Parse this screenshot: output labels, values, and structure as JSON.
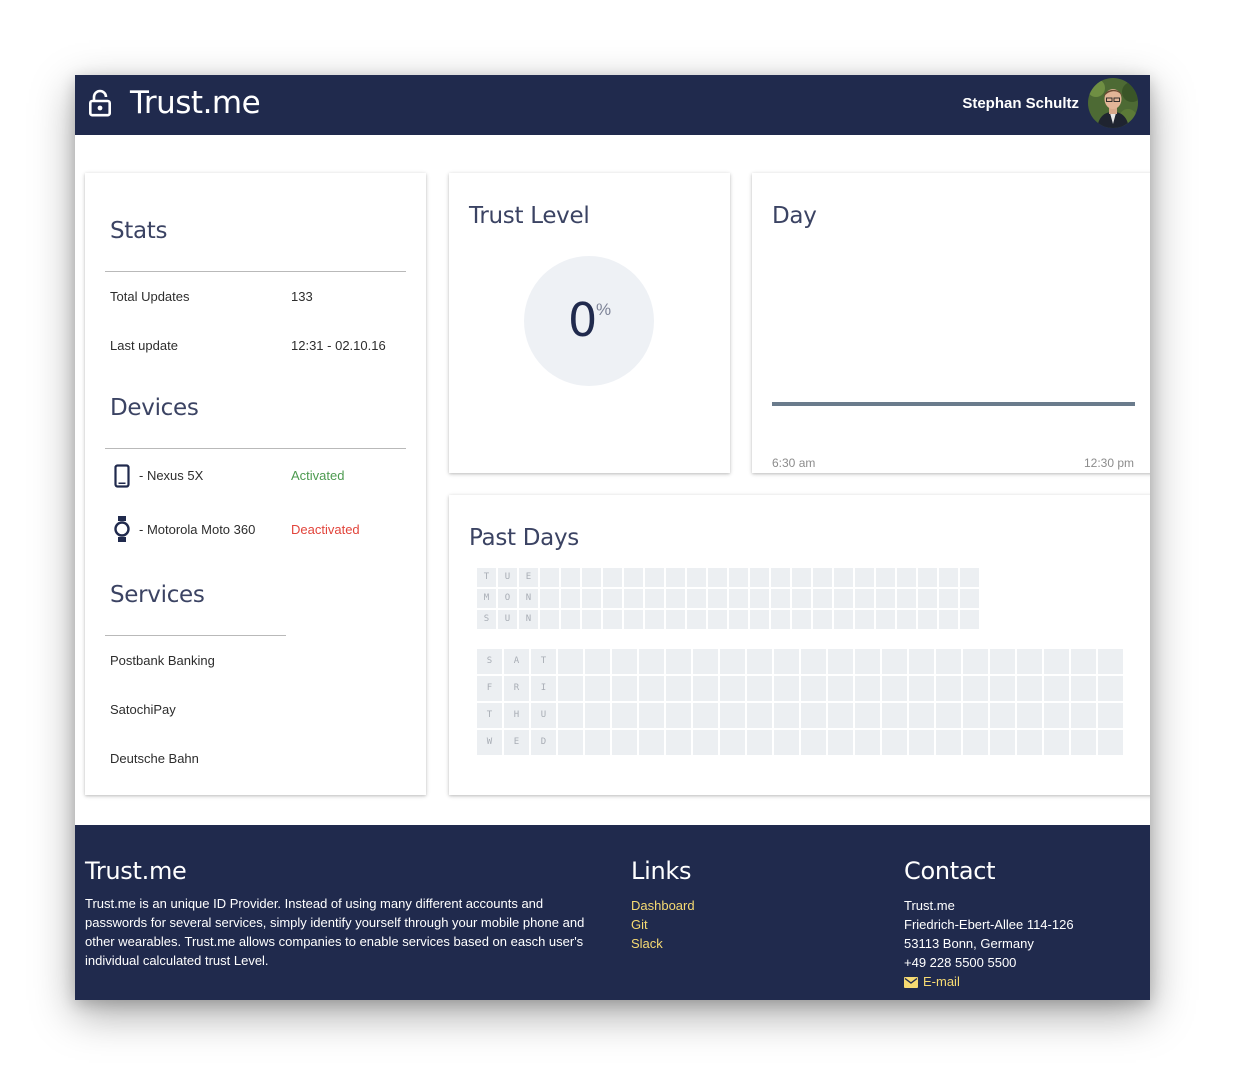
{
  "header": {
    "title": "Trust.me",
    "user_name": "Stephan Schultz"
  },
  "stats": {
    "title": "Stats",
    "rows": [
      {
        "label": "Total Updates",
        "value": "133"
      },
      {
        "label": "Last update",
        "value": "12:31 - 02.10.16"
      }
    ]
  },
  "devices": {
    "title": "Devices",
    "items": [
      {
        "icon": "smartphone-icon",
        "name": "- Nexus 5X",
        "status": "Activated",
        "status_color": "#4c9a4f"
      },
      {
        "icon": "smartwatch-icon",
        "name": "- Motorola Moto 360",
        "status": "Deactivated",
        "status_color": "#e2443b"
      }
    ]
  },
  "services": {
    "title": "Services",
    "items": [
      "Postbank Banking",
      "SatochiPay",
      "Deutsche Bahn"
    ]
  },
  "trust": {
    "title": "Trust Level",
    "value": "0",
    "unit": "%"
  },
  "day": {
    "title": "Day",
    "x_start": "6:30 am",
    "x_end": "12:30 pm"
  },
  "past_days": {
    "title": "Past Days",
    "recent_rows": [
      [
        "T",
        "U",
        "E"
      ],
      [
        "M",
        "O",
        "N"
      ],
      [
        "S",
        "U",
        "N"
      ]
    ],
    "earlier_rows": [
      [
        "S",
        "A",
        "T"
      ],
      [
        "F",
        "R",
        "I"
      ],
      [
        "T",
        "H",
        "U"
      ],
      [
        "W",
        "E",
        "D"
      ]
    ]
  },
  "footer": {
    "about_title": "Trust.me",
    "about_text": "Trust.me is an unique ID Provider. Instead of using many different accounts and passwords for several services, simply identify yourself through your mobile phone and other wearables. Trust.me allows companies to enable services based on easch user's individual calculated trust Level.",
    "links_title": "Links",
    "links": [
      "Dashboard",
      "Git",
      "Slack"
    ],
    "contact_title": "Contact",
    "contact_lines": [
      "Trust.me",
      "Friedrich-Ebert-Allee 114-126",
      "53113 Bonn, Germany",
      "+49 228 5500 5500"
    ],
    "email_label": "E-mail"
  },
  "colors": {
    "primary": "#202a4d",
    "link": "#f6da72",
    "activated": "#4c9a4f",
    "deactivated": "#e2443b"
  }
}
